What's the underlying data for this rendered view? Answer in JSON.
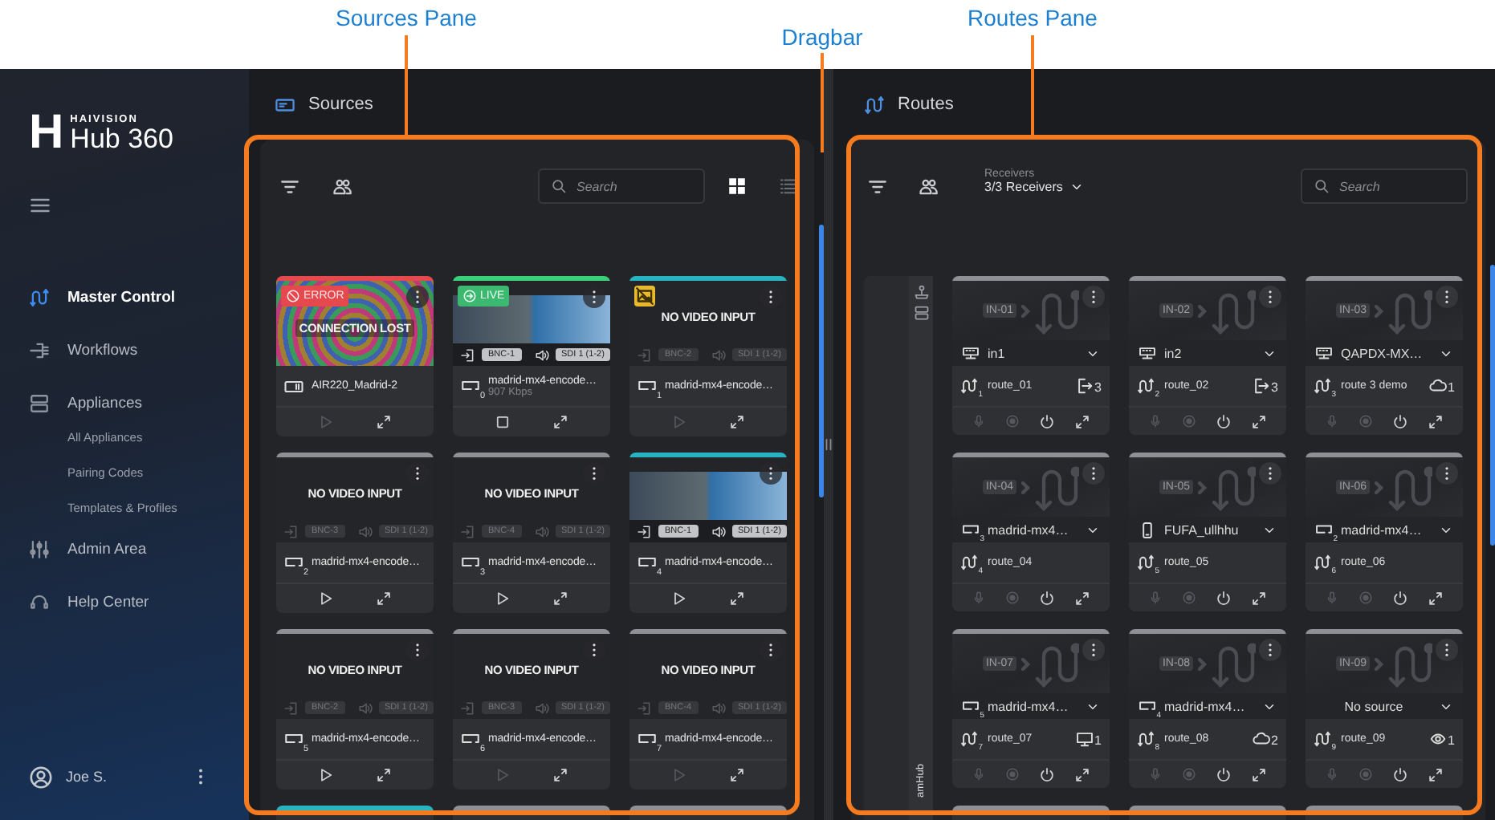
{
  "annotations": [
    {
      "label": "Sources Pane"
    },
    {
      "label": "Dragbar"
    },
    {
      "label": "Routes Pane"
    }
  ],
  "sidebar": {
    "logo": {
      "mark": "H",
      "brand": "HAIVISION",
      "product": "Hub 360"
    },
    "items": [
      {
        "label": "Master Control",
        "selected": true
      },
      {
        "label": "Workflows",
        "selected": false
      },
      {
        "label": "Appliances",
        "selected": false,
        "children": [
          {
            "label": "All Appliances",
            "selected": false
          },
          {
            "label": "Pairing Codes",
            "selected": false
          },
          {
            "label": "Templates & Profiles",
            "selected": false
          }
        ]
      },
      {
        "label": "Admin Area",
        "selected": false
      },
      {
        "label": "Help Center",
        "selected": false
      }
    ],
    "user": {
      "name": "Joe S."
    }
  },
  "sources": {
    "title": "Sources",
    "search": {
      "placeholder": "Search"
    },
    "views": [
      {
        "kind": "grid",
        "selected": true
      },
      {
        "kind": "list",
        "selected": false
      }
    ],
    "cards": [
      {
        "color": "#e5484d",
        "kind": "error",
        "badge": "ERROR",
        "video_preview": false,
        "message": "CONNECTION LOST",
        "device": {
          "kind": "gateway",
          "name": "AIR220_Madrid-2"
        },
        "playing": false,
        "control_disabled": true
      },
      {
        "color": "#3ccf7a",
        "kind": "live",
        "badge": "LIVE",
        "video_preview": true,
        "video_input": "BNC-1",
        "audio_input": "SDI 1 (1-2)",
        "inputs_active": true,
        "device": {
          "kind": "encoder",
          "index": "0",
          "name": "madrid-mx4-encode…"
        },
        "bitrate": "907 Kbps",
        "playing": true,
        "control_disabled": false
      },
      {
        "color": "#27b3c2",
        "kind": "warning",
        "video_preview": false,
        "message": "NO VIDEO INPUT",
        "video_input": "BNC-2",
        "audio_input": "SDI 1 (1-2)",
        "inputs_active": false,
        "device": {
          "kind": "encoder",
          "index": "1",
          "name": "madrid-mx4-encode…"
        },
        "playing": false,
        "control_disabled": true
      },
      {
        "color": "#8e9096",
        "kind": "idle",
        "video_preview": false,
        "message": "NO VIDEO INPUT",
        "video_input": "BNC-3",
        "audio_input": "SDI 1 (1-2)",
        "inputs_active": false,
        "device": {
          "kind": "encoder",
          "index": "2",
          "name": "madrid-mx4-encode…"
        },
        "playing": false,
        "control_disabled": false
      },
      {
        "color": "#8e9096",
        "kind": "idle",
        "video_preview": false,
        "message": "NO VIDEO INPUT",
        "video_input": "BNC-4",
        "audio_input": "SDI 1 (1-2)",
        "inputs_active": false,
        "device": {
          "kind": "encoder",
          "index": "3",
          "name": "madrid-mx4-encode…"
        },
        "playing": false,
        "control_disabled": false
      },
      {
        "color": "#27b3c2",
        "kind": "idle",
        "video_preview": true,
        "video_input": "BNC-1",
        "audio_input": "SDI 1 (1-2)",
        "inputs_active": true,
        "device": {
          "kind": "encoder",
          "index": "4",
          "name": "madrid-mx4-encode…"
        },
        "playing": false,
        "control_disabled": false
      },
      {
        "color": "#8e9096",
        "kind": "idle",
        "video_preview": false,
        "message": "NO VIDEO INPUT",
        "video_input": "BNC-2",
        "audio_input": "SDI 1 (1-2)",
        "inputs_active": false,
        "device": {
          "kind": "encoder",
          "index": "5",
          "name": "madrid-mx4-encode…"
        },
        "playing": false,
        "control_disabled": false
      },
      {
        "color": "#8e9096",
        "kind": "idle",
        "video_preview": false,
        "message": "NO VIDEO INPUT",
        "video_input": "BNC-3",
        "audio_input": "SDI 1 (1-2)",
        "inputs_active": false,
        "device": {
          "kind": "encoder",
          "index": "6",
          "name": "madrid-mx4-encode…"
        },
        "playing": false,
        "control_disabled": true
      },
      {
        "color": "#8e9096",
        "kind": "idle",
        "video_preview": false,
        "message": "NO VIDEO INPUT",
        "video_input": "BNC-4",
        "audio_input": "SDI 1 (1-2)",
        "inputs_active": false,
        "device": {
          "kind": "encoder",
          "index": "7",
          "name": "madrid-mx4-encode…"
        },
        "playing": false,
        "control_disabled": true
      }
    ],
    "more_cards": [
      {
        "color": "#27b3c2"
      },
      {
        "color": "#8e9096"
      },
      {
        "color": "#8e9096"
      }
    ]
  },
  "routes": {
    "title": "Routes",
    "receivers": {
      "label": "Receivers",
      "value": "3/3 Receivers"
    },
    "search": {
      "placeholder": "Search"
    },
    "strip_label": "amHub",
    "cards": [
      {
        "input_tag": "IN-01",
        "source": {
          "kind": "appliance",
          "name": "in1"
        },
        "route_index": "1",
        "route": "route_01",
        "destination": {
          "kind": "exit",
          "count": "3"
        }
      },
      {
        "input_tag": "IN-02",
        "source": {
          "kind": "appliance",
          "name": "in2"
        },
        "route_index": "2",
        "route": "route_02",
        "destination": {
          "kind": "exit",
          "count": "3"
        }
      },
      {
        "input_tag": "IN-03",
        "source": {
          "kind": "appliance",
          "name": "QAPDX-MX…"
        },
        "route_index": "3",
        "route": "route 3 demo",
        "destination": {
          "kind": "cloud",
          "count": "1"
        }
      },
      {
        "input_tag": "IN-04",
        "source": {
          "kind": "encoder",
          "index": "3",
          "name": "madrid-mx4…"
        },
        "route_index": "4",
        "route": "route_04"
      },
      {
        "input_tag": "IN-05",
        "source": {
          "kind": "mobile",
          "name": "FUFA_ullhhu"
        },
        "route_index": "5",
        "route": "route_05"
      },
      {
        "input_tag": "IN-06",
        "source": {
          "kind": "encoder",
          "index": "2",
          "name": "madrid-mx4…"
        },
        "route_index": "6",
        "route": "route_06"
      },
      {
        "input_tag": "IN-07",
        "source": {
          "kind": "encoder",
          "index": "5",
          "name": "madrid-mx4…"
        },
        "route_index": "7",
        "route": "route_07",
        "destination": {
          "kind": "monitor",
          "count": "1"
        }
      },
      {
        "input_tag": "IN-08",
        "source": {
          "kind": "encoder",
          "index": "4",
          "name": "madrid-mx4…"
        },
        "route_index": "8",
        "route": "route_08",
        "destination": {
          "kind": "cloud",
          "count": "2"
        }
      },
      {
        "input_tag": "IN-09",
        "source": {
          "kind": "none",
          "name": "No source"
        },
        "route_index": "9",
        "route": "route_09",
        "destination": {
          "kind": "viewer",
          "count": "1"
        }
      }
    ],
    "more_cards": [
      {
        "color": "#8e9096"
      },
      {
        "color": "#8e9096"
      },
      {
        "color": "#8e9096"
      }
    ]
  }
}
